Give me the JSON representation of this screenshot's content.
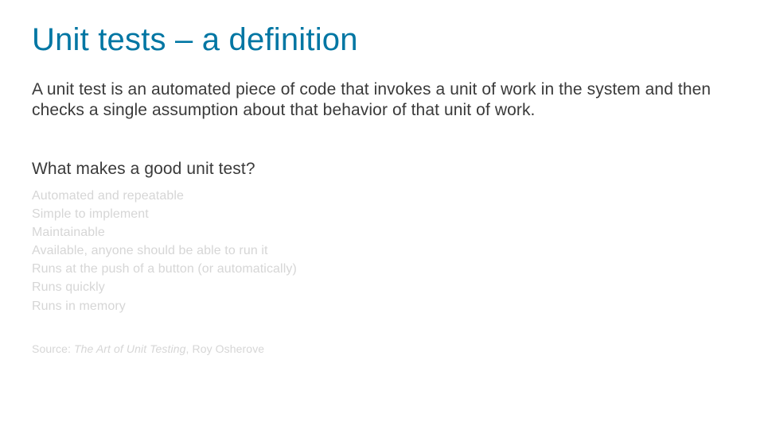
{
  "slide": {
    "title": "Unit tests – a definition",
    "definition": "A unit test is an automated piece of code that invokes a unit of work in the system and then checks a single assumption about that behavior of that unit of work.",
    "subheading": "What makes a good unit test?",
    "bullets": [
      "Automated and repeatable",
      "Simple to implement",
      "Maintainable",
      "Available, anyone should be able to run it",
      "Runs at the push of a button (or automatically)",
      "Runs quickly",
      "Runs in memory"
    ],
    "source_prefix": "Source: ",
    "source_book": "The Art of Unit Testing",
    "source_author": ", Roy Osherove"
  }
}
